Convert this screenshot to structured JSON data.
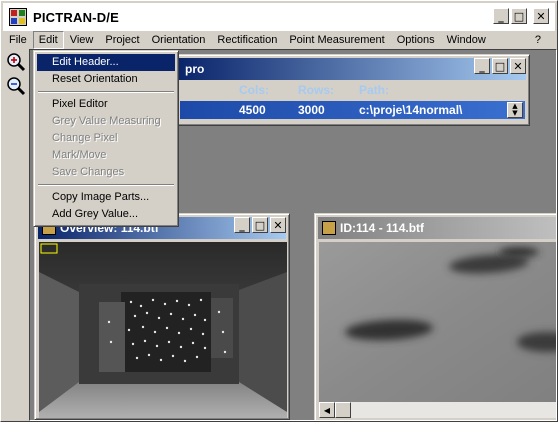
{
  "app": {
    "title": "PICTRAN-D/E"
  },
  "window_buttons": {
    "minimize": "_",
    "maximize": "□",
    "close": "✕"
  },
  "menubar": {
    "items": [
      "File",
      "Edit",
      "View",
      "Project",
      "Orientation",
      "Rectification",
      "Point Measurement",
      "Options",
      "Window"
    ],
    "help": "?"
  },
  "toolbar": {
    "zoom_in_icon": "zoom-in-icon",
    "zoom_out_icon": "zoom-out-icon"
  },
  "edit_menu": {
    "groups": [
      [
        {
          "label": "Edit Header...",
          "state": "highlighted"
        },
        {
          "label": "Reset Orientation",
          "state": "enabled"
        }
      ],
      [
        {
          "label": "Pixel Editor",
          "state": "enabled"
        },
        {
          "label": "Grey Value Measuring",
          "state": "disabled"
        },
        {
          "label": "Change Pixel",
          "state": "disabled"
        },
        {
          "label": "Mark/Move",
          "state": "disabled"
        },
        {
          "label": "Save Changes",
          "state": "disabled"
        }
      ],
      [
        {
          "label": "Copy Image Parts...",
          "state": "enabled"
        },
        {
          "label": "Add Grey Value...",
          "state": "enabled"
        }
      ]
    ]
  },
  "header_window": {
    "title": "pro",
    "columns": {
      "cols": "Cols:",
      "rows": "Rows:",
      "path": "Path:"
    },
    "row": {
      "cols": "4500",
      "rows": "3000",
      "path": "c:\\proje\\14normal\\"
    }
  },
  "overview_window": {
    "title": "Overview: 114.btf"
  },
  "image_window": {
    "title": "ID:114 - 114.btf"
  },
  "colors": {
    "active_title": "#0a246a",
    "selection": "#0a246a",
    "face": "#d4d0c8",
    "mdi": "#808080"
  }
}
